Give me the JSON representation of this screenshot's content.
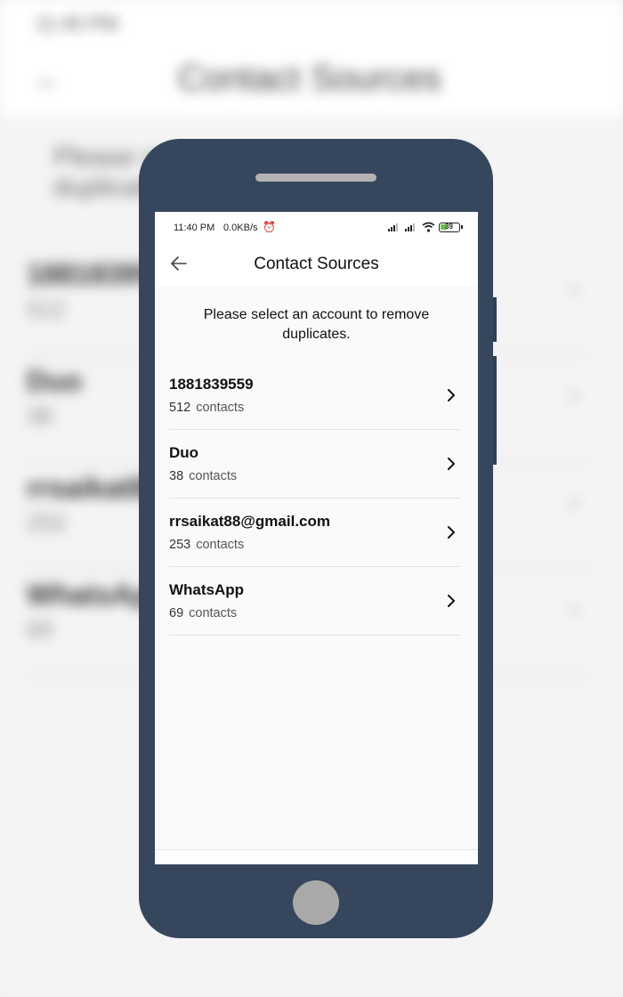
{
  "status_bar": {
    "time": "11:40 PM",
    "speed": "0.0KB/s",
    "battery": "39",
    "icons": [
      "alarm-icon",
      "signal-icon",
      "signal-icon",
      "wifi-icon",
      "battery-icon"
    ]
  },
  "app_bar": {
    "title": "Contact Sources",
    "back_icon": "arrow-left-icon"
  },
  "prompt": "Please select an account to remove duplicates.",
  "accounts": [
    {
      "name": "1881839559",
      "count": "512",
      "label": "contacts"
    },
    {
      "name": "Duo",
      "count": "38",
      "label": "contacts"
    },
    {
      "name": "rrsaikat88@gmail.com",
      "count": "253",
      "label": "contacts"
    },
    {
      "name": "WhatsApp",
      "count": "69",
      "label": "contacts"
    }
  ],
  "colors": {
    "phone_frame": "#36465d",
    "battery_fill": "#6abf4b",
    "screen_bg": "#fafafa"
  }
}
